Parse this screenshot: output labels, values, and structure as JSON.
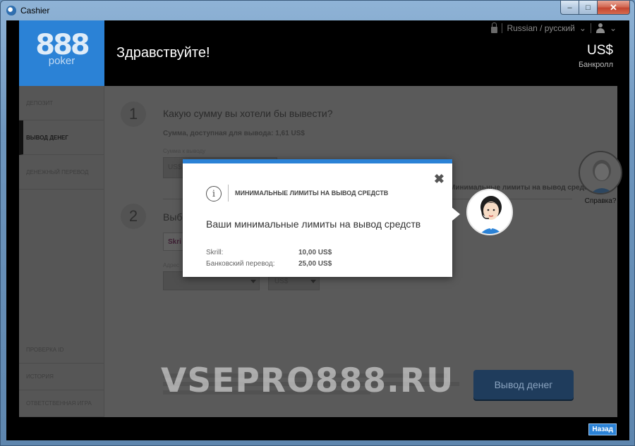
{
  "window": {
    "title": "Cashier",
    "minimize": "–",
    "maximize": "□",
    "close": "✕"
  },
  "header": {
    "logo_number": "888",
    "logo_word": "poker",
    "greeting": "Здравствуйте!",
    "language": "Russian / русский",
    "currency": "US$",
    "bankroll_label": "Банкролл"
  },
  "sidebar": {
    "items": [
      {
        "label": "Депозит"
      },
      {
        "label": "Вывод денег"
      },
      {
        "label": "Денежный перевод"
      }
    ],
    "bottom_items": [
      {
        "label": "Проверка ID"
      },
      {
        "label": "История"
      },
      {
        "label": "Ответственная игра"
      }
    ]
  },
  "main": {
    "step1": {
      "number": "1",
      "title": "Какую сумму вы хотели бы вывести?"
    },
    "available": "Сумма, доступная для вывода: 1,61 US$",
    "amount_label": "Сумма к выводу",
    "amount_placeholder": "US$",
    "limits_link": "Минимальные лимиты на вывод средств",
    "step2": {
      "number": "2",
      "title": "Выбе"
    },
    "method_tile": "Skri",
    "address_label": "Адрес",
    "currency_select": "US$",
    "withdraw_button": "Вывод денег",
    "help_label": "Справка?"
  },
  "watermark": "VSEPRO888.RU",
  "footer": {
    "back_button": "Назад"
  },
  "modal": {
    "title": "Минимальные лимиты на вывод средств",
    "info_glyph": "i",
    "close_glyph": "✖",
    "heading": "Ваши минимальные лимиты на вывод средств",
    "limits": [
      {
        "method": "Skrill:",
        "amount": "10,00 US$"
      },
      {
        "method": "Банковский перевод:",
        "amount": "25,00 US$"
      }
    ]
  }
}
